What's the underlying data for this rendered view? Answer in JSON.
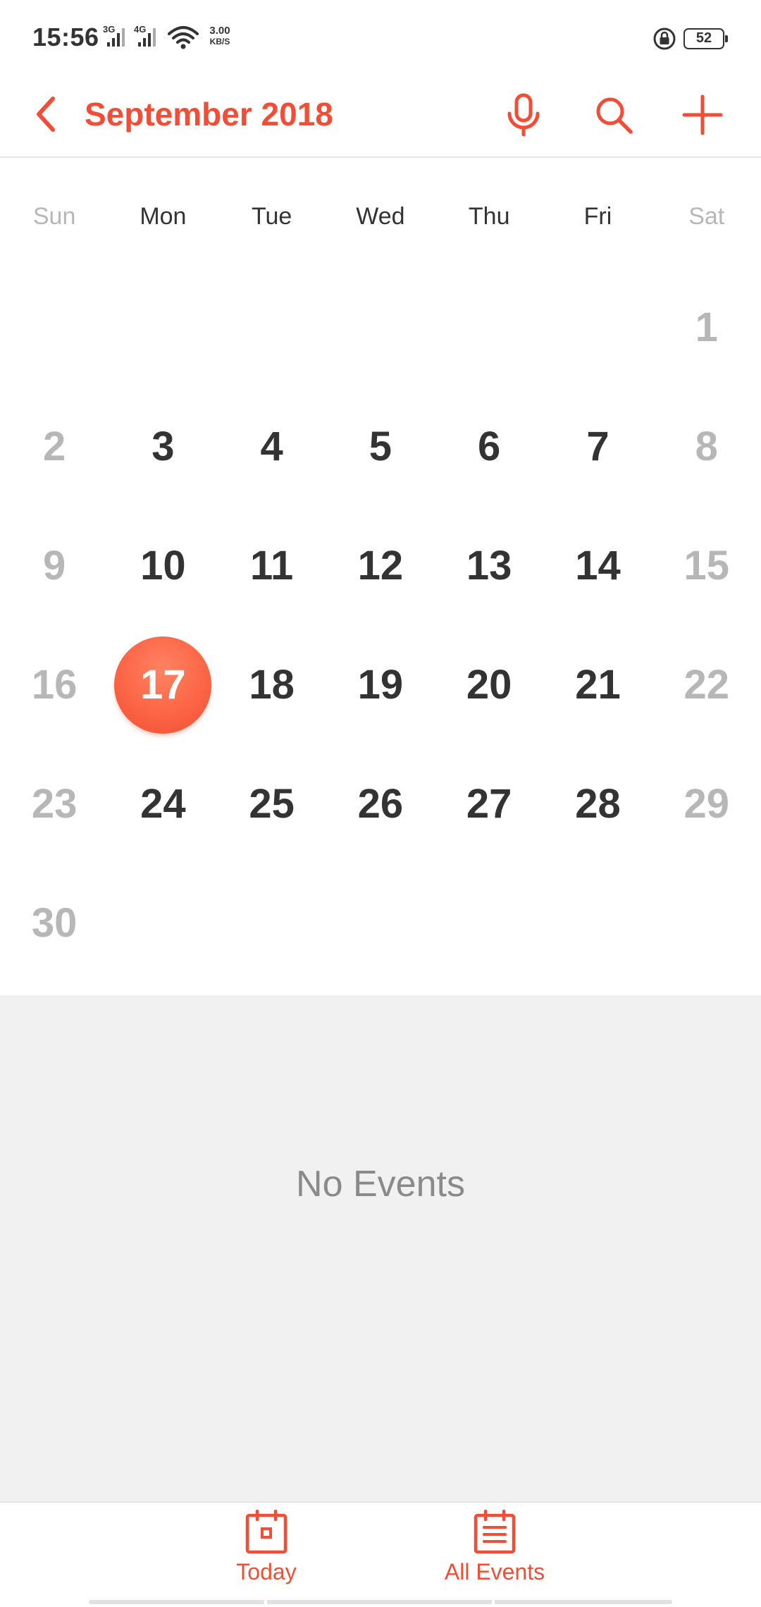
{
  "status_bar": {
    "time": "15:56",
    "net1": "3G",
    "net2": "4G",
    "speed_value": "3.00",
    "speed_unit": "KB/S",
    "battery": "52",
    "icons": [
      "signal-icon",
      "wifi-icon",
      "rotation-lock-icon",
      "battery-icon"
    ]
  },
  "toolbar": {
    "title": "September 2018",
    "icons": [
      "back-arrow-icon",
      "microphone-icon",
      "search-icon",
      "plus-icon"
    ],
    "accent_color": "#f24d36"
  },
  "calendar": {
    "weekdays": [
      "Sun",
      "Mon",
      "Tue",
      "Wed",
      "Thu",
      "Fri",
      "Sat"
    ],
    "selected_day": "17",
    "selected_color": "#fb6545",
    "weeks": [
      [
        "",
        "",
        "",
        "",
        "",
        "",
        "1"
      ],
      [
        "2",
        "3",
        "4",
        "5",
        "6",
        "7",
        "8"
      ],
      [
        "9",
        "10",
        "11",
        "12",
        "13",
        "14",
        "15"
      ],
      [
        "16",
        "17",
        "18",
        "19",
        "20",
        "21",
        "22"
      ],
      [
        "23",
        "24",
        "25",
        "26",
        "27",
        "28",
        "29"
      ],
      [
        "30",
        "",
        "",
        "",
        "",
        "",
        ""
      ]
    ]
  },
  "events": {
    "empty_text": "No Events"
  },
  "bottom_nav": {
    "today_label": "Today",
    "all_events_label": "All Events",
    "icons": [
      "calendar-today-icon",
      "calendar-list-icon"
    ]
  }
}
